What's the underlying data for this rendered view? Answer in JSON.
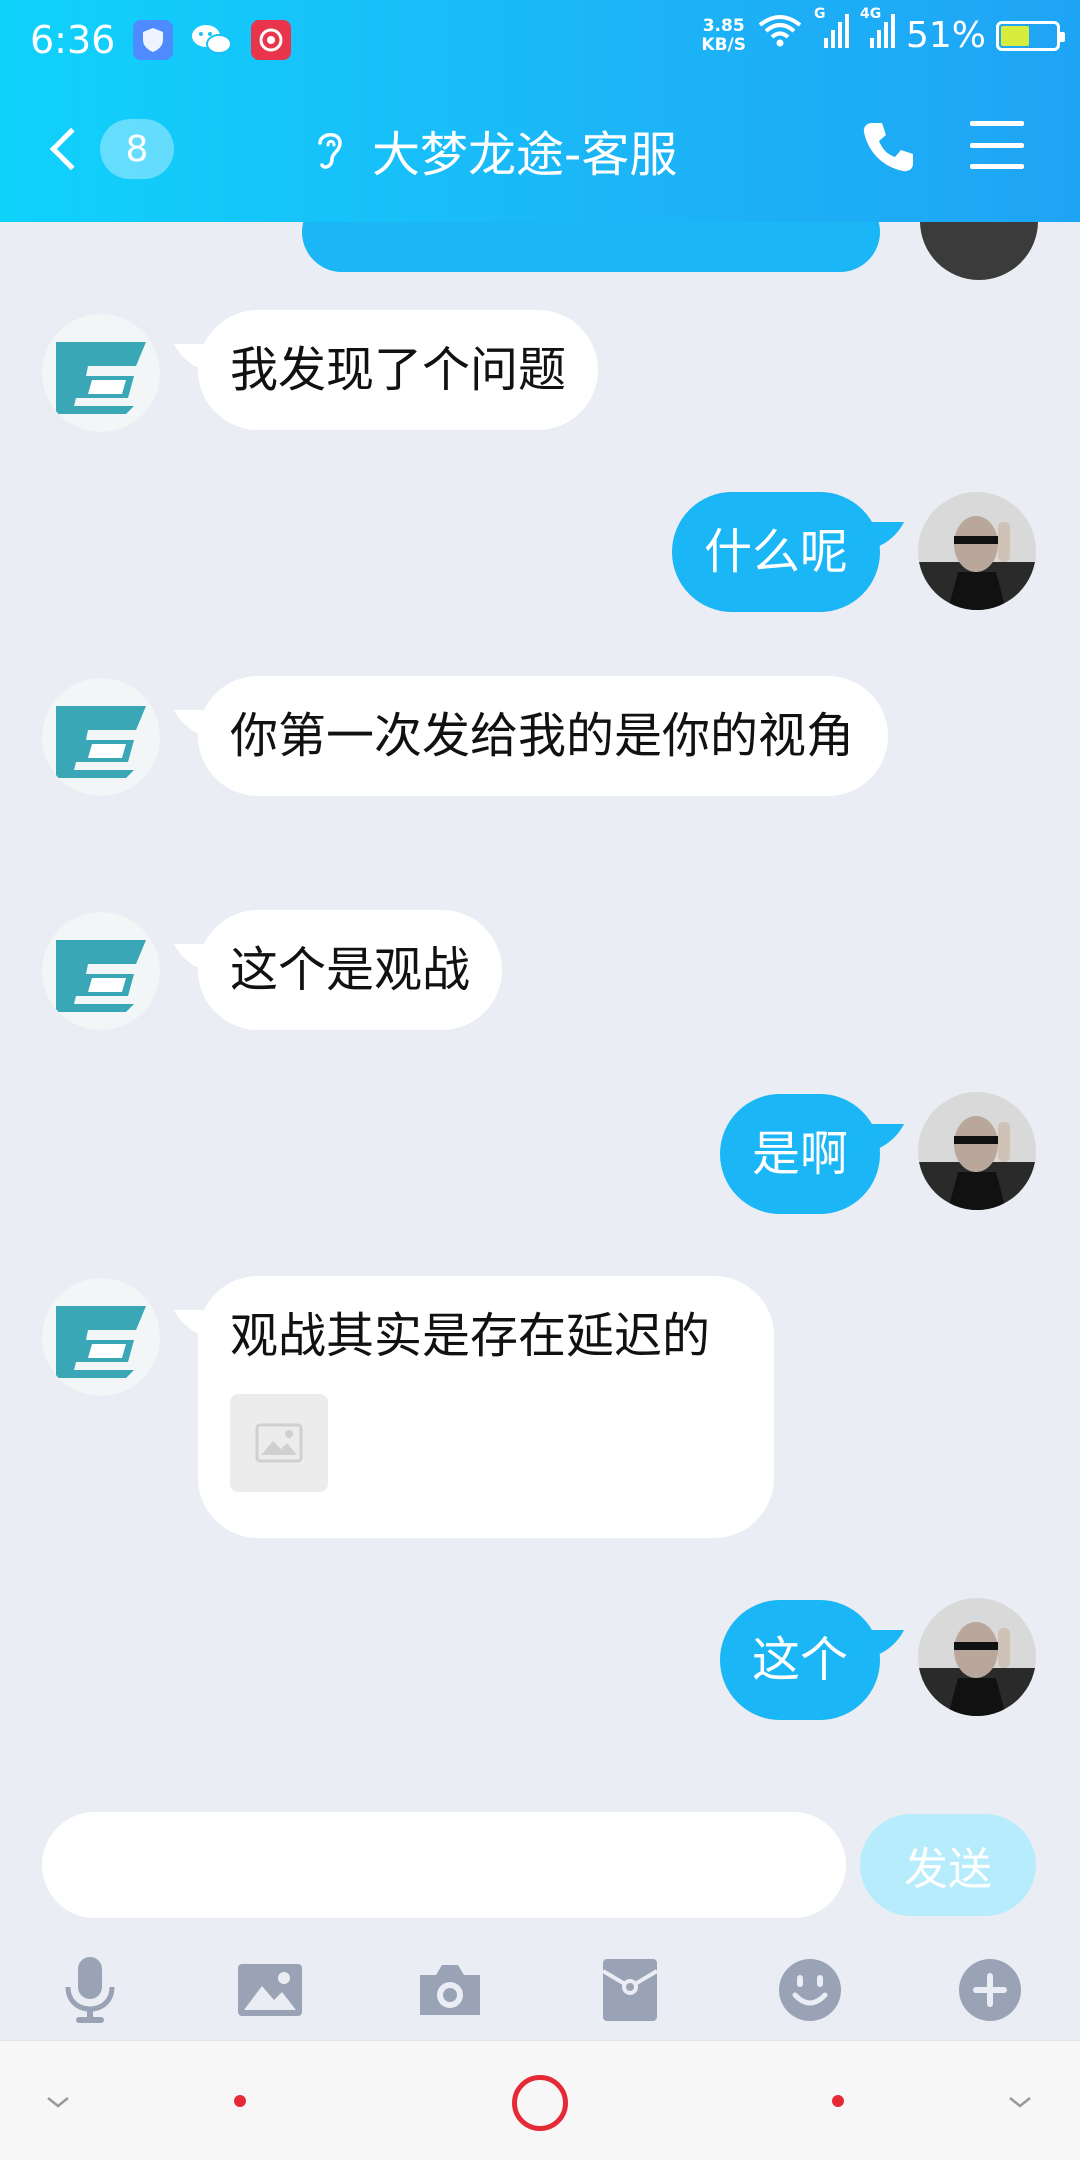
{
  "status_bar": {
    "time": "6:36",
    "net_speed_top": "3.85",
    "net_speed_bottom": "KB/S",
    "signal_labels": [
      "G",
      "4G"
    ],
    "battery": "51%",
    "battery_level": 0.51,
    "icons": [
      "shield-icon",
      "wechat-icon",
      "screen-recorder-icon",
      "wifi-icon",
      "signal-icon",
      "battery-icon"
    ]
  },
  "header": {
    "unread_count": "8",
    "title": "大梦龙途-客服",
    "icons": [
      "back-chevron-icon",
      "ear-icon",
      "phone-icon",
      "menu-icon"
    ],
    "gradient": [
      "#0fd2fb",
      "#1ea4f5"
    ]
  },
  "messages": [
    {
      "from": "other",
      "text": "我发现了个问题"
    },
    {
      "from": "me",
      "text": "什么呢"
    },
    {
      "from": "other",
      "text": "你第一次发给我的是你的视角"
    },
    {
      "from": "other",
      "text": "这个是观战"
    },
    {
      "from": "me",
      "text": "是啊"
    },
    {
      "from": "other",
      "text": "观战其实是存在延迟的",
      "has_image": true
    },
    {
      "from": "me",
      "text": "这个"
    }
  ],
  "input": {
    "value": "",
    "placeholder": "",
    "send_label": "发送"
  },
  "toolbar": {
    "icons": [
      "microphone-icon",
      "image-icon",
      "camera-icon",
      "red-packet-icon",
      "emoji-icon",
      "plus-icon"
    ]
  },
  "colors": {
    "my_bubble": "#1ab6f5",
    "other_bubble": "#ffffff",
    "background": "#eaedf4",
    "send_button": "#b6ecfb",
    "nav_accent": "#e52a37"
  }
}
